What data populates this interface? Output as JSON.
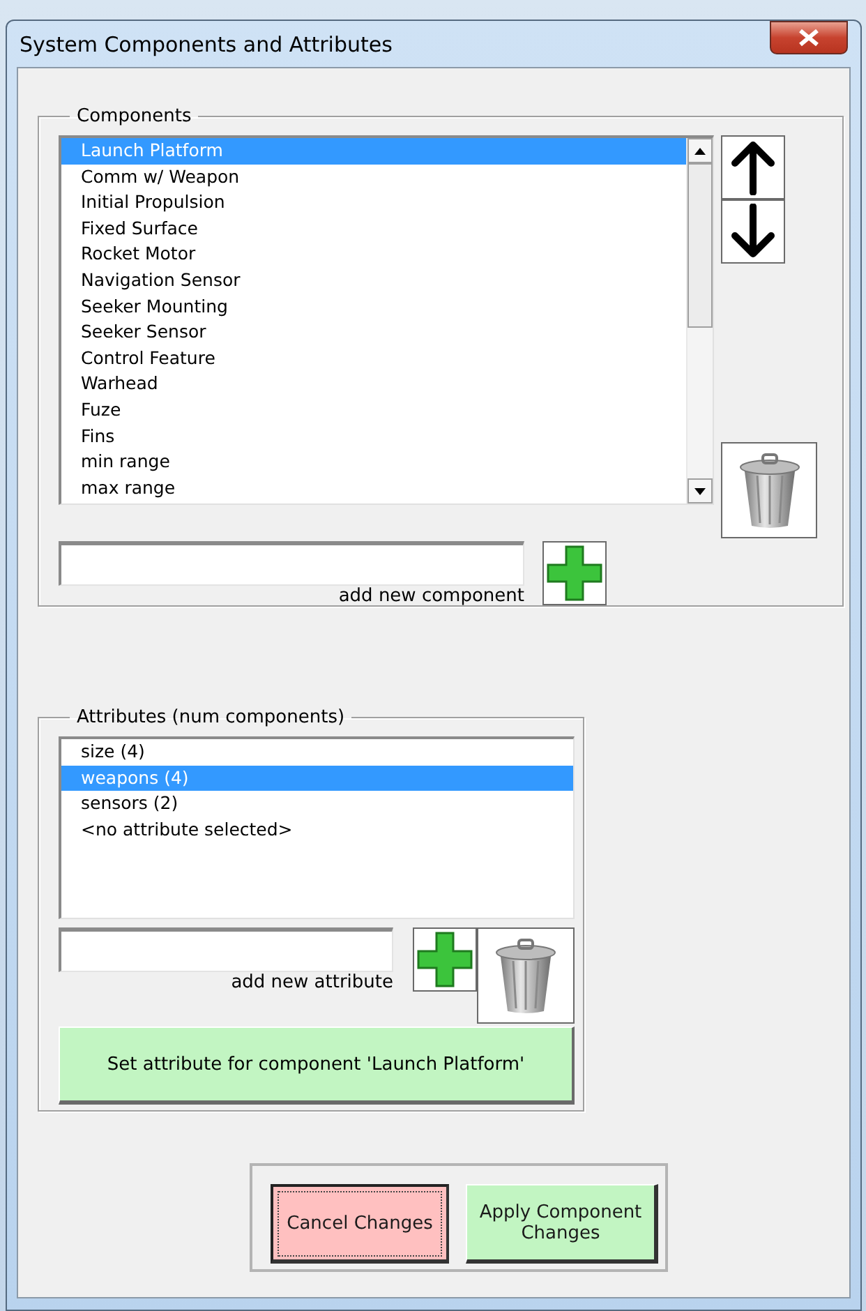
{
  "window": {
    "title": "System Components and Attributes"
  },
  "components": {
    "label": "Components",
    "items": [
      {
        "label": "Launch Platform",
        "selected": true
      },
      {
        "label": "Comm w/ Weapon",
        "selected": false
      },
      {
        "label": "Initial Propulsion",
        "selected": false
      },
      {
        "label": "Fixed Surface",
        "selected": false
      },
      {
        "label": "Rocket Motor",
        "selected": false
      },
      {
        "label": "Navigation Sensor",
        "selected": false
      },
      {
        "label": "Seeker Mounting",
        "selected": false
      },
      {
        "label": "Seeker Sensor",
        "selected": false
      },
      {
        "label": "Control Feature",
        "selected": false
      },
      {
        "label": "Warhead",
        "selected": false
      },
      {
        "label": "Fuze",
        "selected": false
      },
      {
        "label": "Fins",
        "selected": false
      },
      {
        "label": "min range",
        "selected": false
      },
      {
        "label": "max range",
        "selected": false
      }
    ],
    "add_label": "add new component"
  },
  "attributes": {
    "label": "Attributes (num components)",
    "items": [
      {
        "label": "size (4)",
        "selected": false
      },
      {
        "label": "weapons (4)",
        "selected": true
      },
      {
        "label": "sensors (2)",
        "selected": false
      },
      {
        "label": "<no attribute selected>",
        "selected": false
      }
    ],
    "add_label": "add new attribute",
    "set_button": "Set attribute for component 'Launch Platform'"
  },
  "buttons": [
    {
      "label": "Cancel Changes",
      "kind": "cancel",
      "focused": true
    },
    {
      "label": "Apply Component Changes",
      "kind": "apply",
      "focused": false
    }
  ]
}
